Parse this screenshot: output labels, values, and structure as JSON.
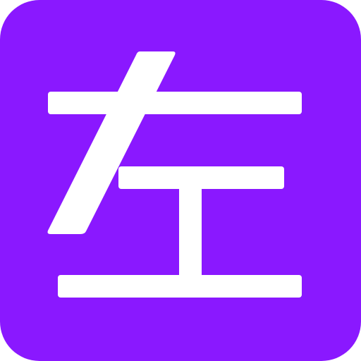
{
  "icon": {
    "name": "左",
    "background_color": "#8A18FF",
    "glyph_color": "#FFFFFF"
  }
}
